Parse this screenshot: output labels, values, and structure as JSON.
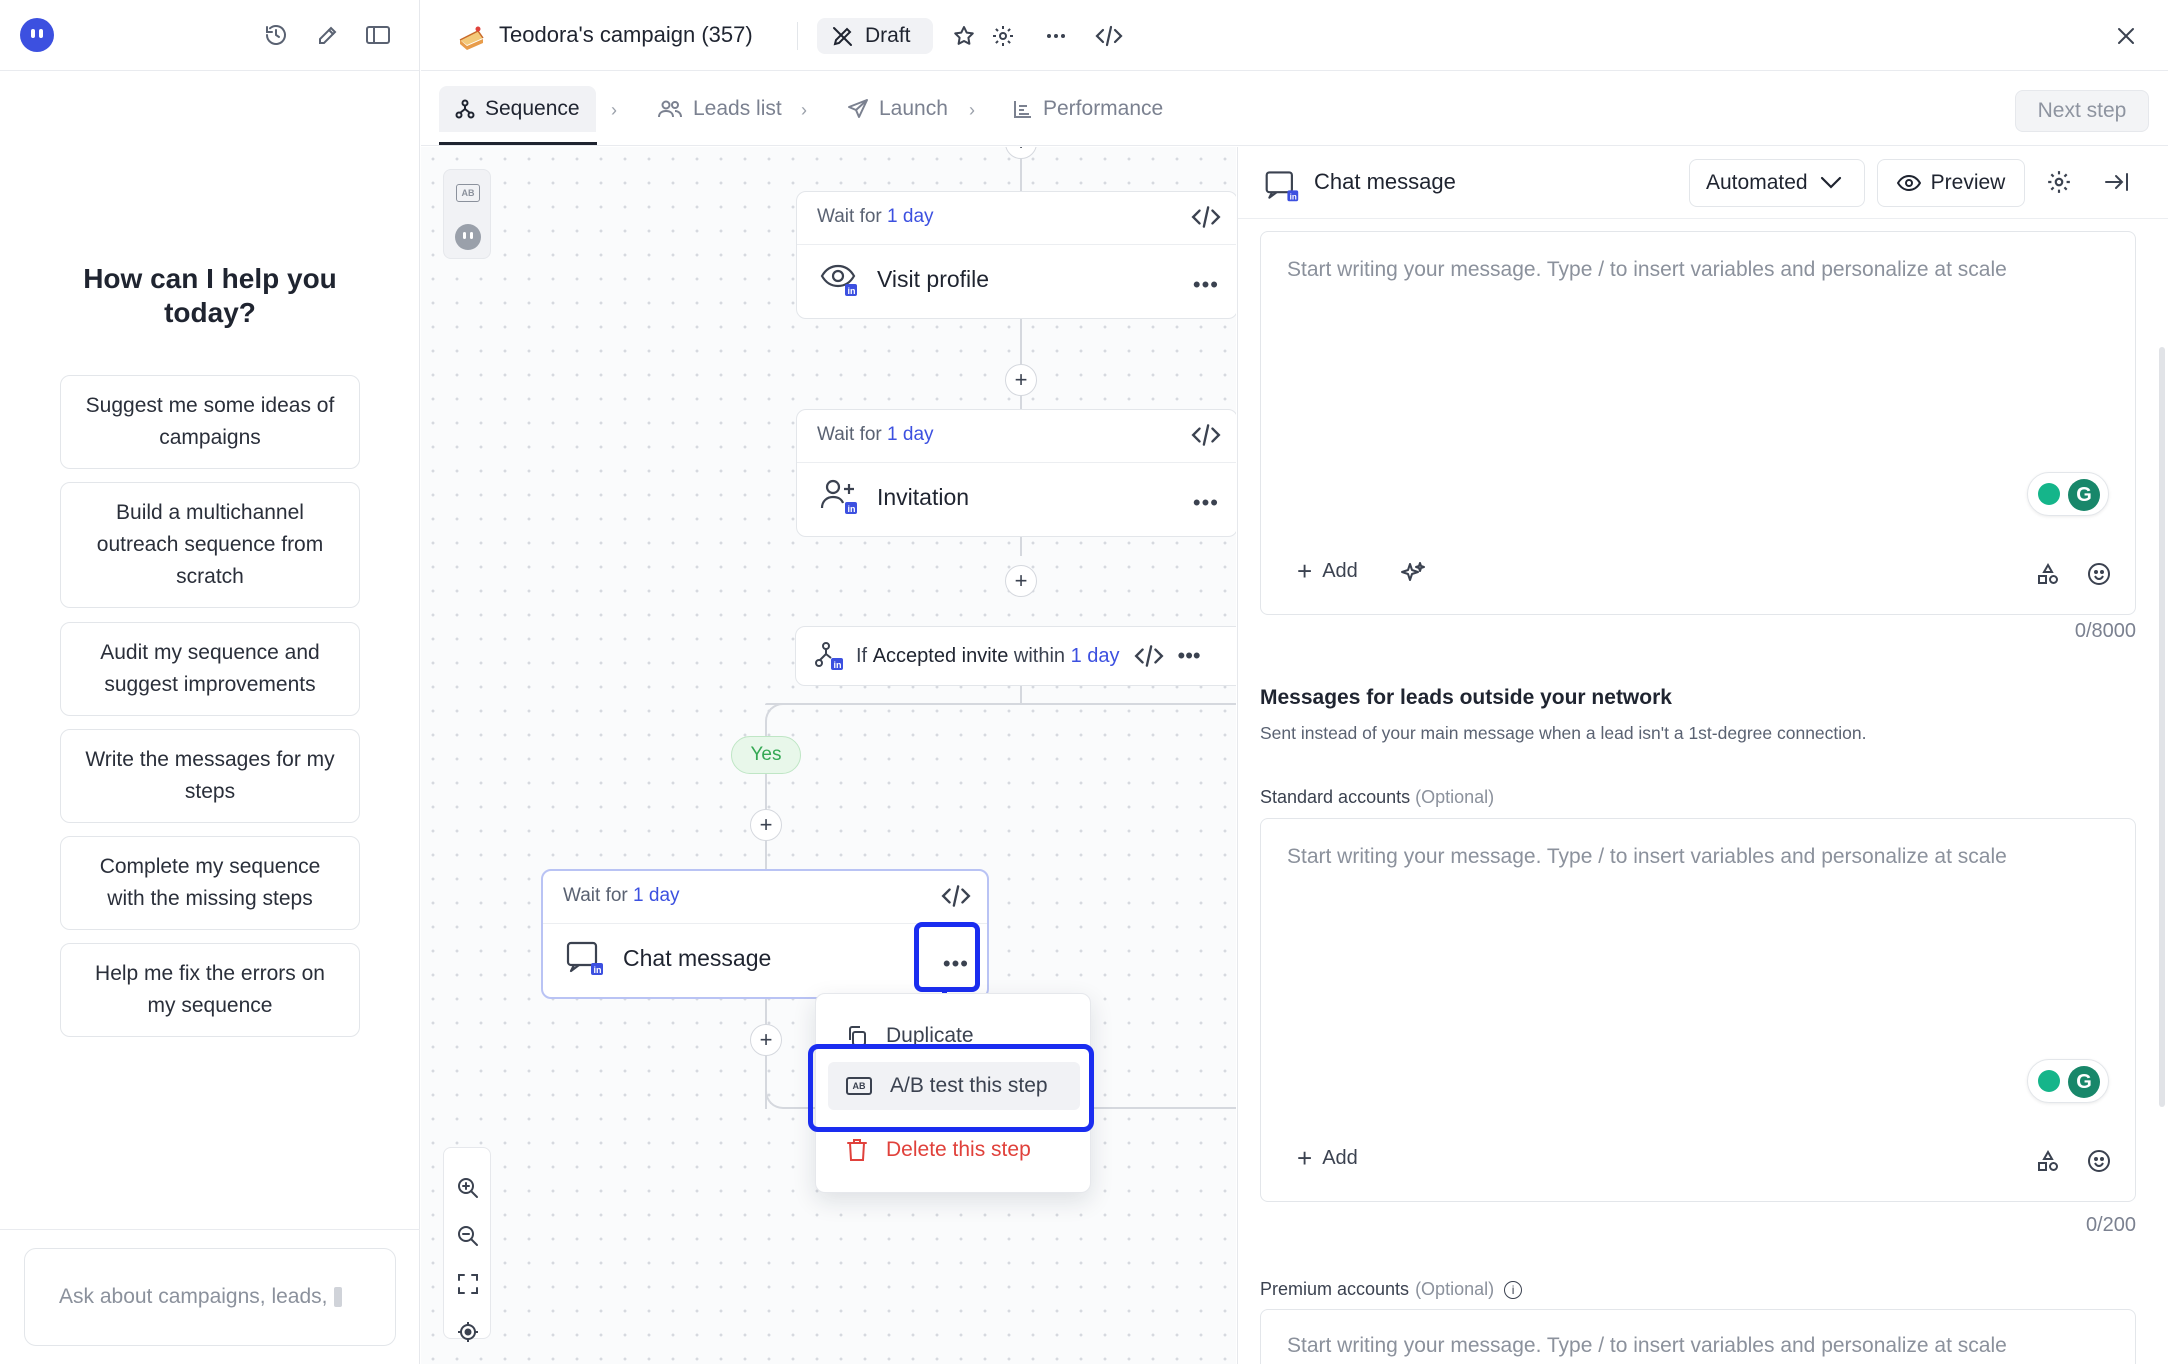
{
  "left_panel": {
    "help_title": "How can I help you today?",
    "suggestions": [
      "Suggest me some ideas of campaigns",
      "Build a multichannel outreach sequence from scratch",
      "Audit my sequence and suggest improvements",
      "Write the messages for my steps",
      "Complete my sequence with the missing steps",
      "Help me fix the errors on my sequence"
    ],
    "ask_placeholder": "Ask about campaigns, leads,"
  },
  "header": {
    "campaign_title": "Teodora's campaign (357)",
    "status": "Draft"
  },
  "tabs": [
    {
      "label": "Sequence",
      "active": true
    },
    {
      "label": "Leads list",
      "active": false
    },
    {
      "label": "Launch",
      "active": false
    },
    {
      "label": "Performance",
      "active": false
    }
  ],
  "next_step_label": "Next step",
  "canvas": {
    "nodes": [
      {
        "wait_prefix": "Wait for",
        "wait_value": "1 day",
        "title": "Visit profile",
        "icon": "eye-linkedin-icon"
      },
      {
        "wait_prefix": "Wait for",
        "wait_value": "1 day",
        "title": "Invitation",
        "icon": "user-add-linkedin-icon"
      },
      {
        "wait_prefix": "Wait for",
        "wait_value": "1 day",
        "title": "Chat message",
        "icon": "chat-linkedin-icon"
      }
    ],
    "condition": {
      "prefix": "If",
      "bold": "Accepted invite",
      "middle": "within",
      "value": "1 day"
    },
    "yes_label": "Yes",
    "context_menu": {
      "items": [
        {
          "label": "Duplicate",
          "icon": "copy-icon"
        },
        {
          "label": "A/B test this step",
          "icon": "ab-test-icon",
          "highlighted": true
        },
        {
          "label": "Delete this step",
          "icon": "trash-icon",
          "danger": true
        }
      ]
    }
  },
  "right_panel": {
    "title": "Chat message",
    "mode": "Automated",
    "preview_label": "Preview",
    "main_editor": {
      "placeholder": "Start writing your message. Type / to insert variables and personalize at scale",
      "add_label": "Add",
      "counter": "0/8000"
    },
    "outside_network": {
      "title": "Messages for leads outside your network",
      "subtitle": "Sent instead of your main message when a lead isn't a 1st-degree connection."
    },
    "standard": {
      "label": "Standard accounts",
      "optional": "(Optional)",
      "placeholder": "Start writing your message. Type / to insert variables and personalize at scale",
      "add_label": "Add",
      "counter": "0/200"
    },
    "premium": {
      "label": "Premium accounts",
      "optional": "(Optional)",
      "placeholder": "Start writing your message. Type / to insert variables and personalize at scale"
    }
  },
  "colors": {
    "accent": "#3c50e0",
    "annotation": "#1a2df0",
    "danger": "#e0413b",
    "yes": "#34a853"
  }
}
